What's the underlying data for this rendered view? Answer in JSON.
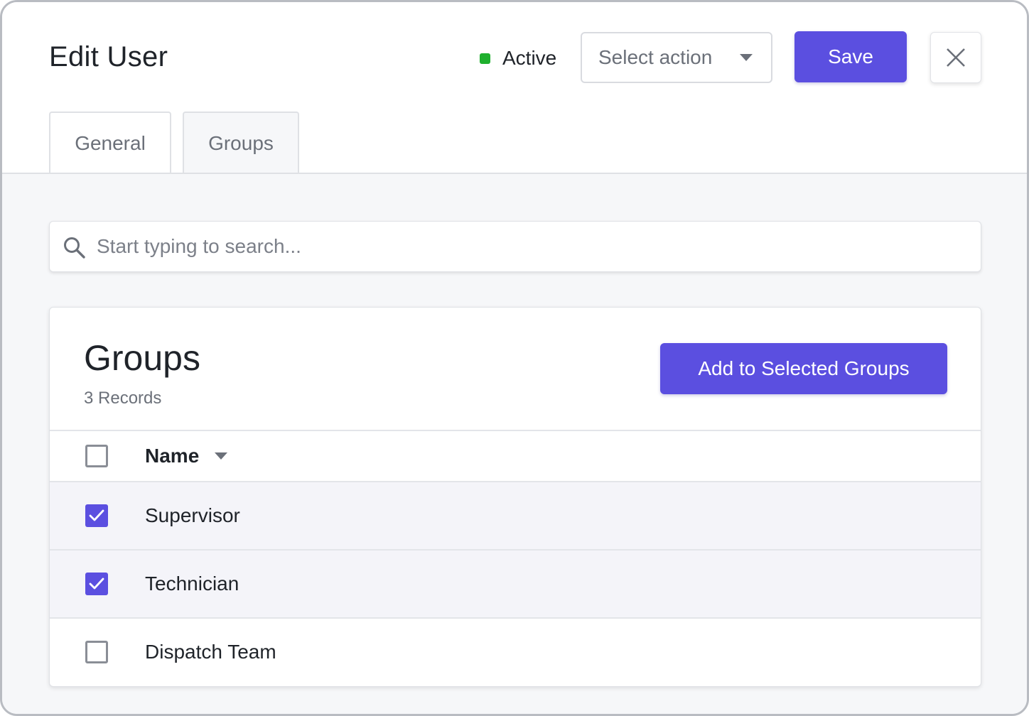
{
  "header": {
    "title": "Edit User",
    "status": {
      "label": "Active",
      "color": "#1fb02e"
    },
    "select_action": {
      "placeholder": "Select action"
    },
    "save_label": "Save",
    "close_icon": "close-icon"
  },
  "tabs": [
    {
      "label": "General",
      "active": false
    },
    {
      "label": "Groups",
      "active": true
    }
  ],
  "search": {
    "placeholder": "Start typing to search...",
    "value": ""
  },
  "groups_card": {
    "title": "Groups",
    "record_count": "3 Records",
    "add_button_label": "Add to Selected Groups",
    "table": {
      "columns": [
        {
          "label": "Name",
          "sort_icon": "chevron-down-icon"
        }
      ],
      "select_all_checked": false,
      "rows": [
        {
          "name": "Supervisor",
          "checked": true
        },
        {
          "name": "Technician",
          "checked": true
        },
        {
          "name": "Dispatch Team",
          "checked": false
        }
      ]
    }
  },
  "colors": {
    "accent": "#5b4fe0",
    "background": "#f6f7f9",
    "border": "#dfe1e5"
  }
}
